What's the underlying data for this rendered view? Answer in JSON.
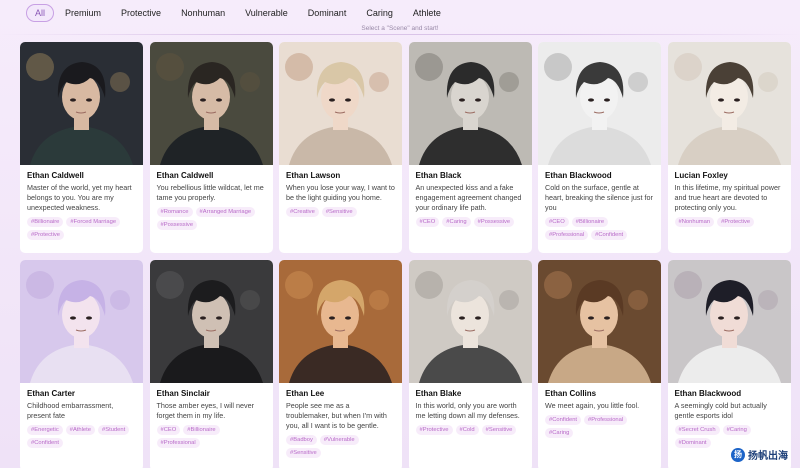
{
  "filters": [
    {
      "label": "All",
      "active": true
    },
    {
      "label": "Premium"
    },
    {
      "label": "Protective"
    },
    {
      "label": "Nonhuman"
    },
    {
      "label": "Vulnerable"
    },
    {
      "label": "Dominant"
    },
    {
      "label": "Caring"
    },
    {
      "label": "Athlete"
    }
  ],
  "subtitle": "Select a \"Scene\" and start!",
  "cards": [
    {
      "name": "Ethan Caldwell",
      "desc": "Master of the world, yet my heart belongs to you. You are my unexpected weakness.",
      "tags": [
        "#Billionaire",
        "#Forced Marriage",
        "#Protective"
      ]
    },
    {
      "name": "Ethan Caldwell",
      "desc": "You rebellious little wildcat, let me tame you properly.",
      "tags": [
        "#Romance",
        "#Arranged Marriage",
        "#Possessive"
      ]
    },
    {
      "name": "Ethan Lawson",
      "desc": "When you lose your way, I want to be the light guiding you home.",
      "tags": [
        "#Creative",
        "#Sensitive"
      ]
    },
    {
      "name": "Ethan Black",
      "desc": "An unexpected kiss and a fake engagement agreement changed your ordinary life path.",
      "tags": [
        "#CEO",
        "#Caring",
        "#Possessive"
      ]
    },
    {
      "name": "Ethan Blackwood",
      "desc": "Cold on the surface, gentle at heart, breaking the silence just for you",
      "tags": [
        "#CEO",
        "#Billionaire",
        "#Professional",
        "#Confident"
      ]
    },
    {
      "name": "Lucian Foxley",
      "desc": "In this lifetime, my spiritual power and true heart are devoted to protecting only you.",
      "tags": [
        "#Nonhuman",
        "#Protective"
      ]
    },
    {
      "name": "Ethan Carter",
      "desc": "Childhood embarrassment, present fate",
      "tags": [
        "#Energetic",
        "#Athlete",
        "#Student",
        "#Confident"
      ]
    },
    {
      "name": "Ethan Sinclair",
      "desc": "Those amber eyes, I will never forget them in my life.",
      "tags": [
        "#CEO",
        "#Billionaire",
        "#Professional"
      ]
    },
    {
      "name": "Ethan Lee",
      "desc": "People see me as a troublemaker, but when I'm with you, all I want is to be gentle.",
      "tags": [
        "#Badboy",
        "#Vulnerable",
        "#Sensitive"
      ]
    },
    {
      "name": "Ethan Blake",
      "desc": "In this world, only you are worth me letting down all my defenses.",
      "tags": [
        "#Protective",
        "#Cold",
        "#Sensitive"
      ]
    },
    {
      "name": "Ethan Collins",
      "desc": "We meet again, you little fool.",
      "tags": [
        "#Confident",
        "#Professional",
        "#Caring"
      ]
    },
    {
      "name": "Ethan Blackwood",
      "desc": "A seemingly cold but actually gentle esports idol",
      "tags": [
        "#Secret Crush",
        "#Caring",
        "#Dominant"
      ]
    }
  ],
  "card_images": [
    {
      "icon": "portrait-city-night-icon",
      "bg": "#2a2e35",
      "accent": "#c9a56a",
      "hair": "#1a1a1e",
      "skin": "#d8b9a2",
      "cloth": "#2b3a3a"
    },
    {
      "icon": "portrait-dark-suit-icon",
      "bg": "#4a4a3e",
      "accent": "#6a5a40",
      "hair": "#2a2622",
      "skin": "#d6bba6",
      "cloth": "#1f2326"
    },
    {
      "icon": "portrait-glasses-blonde-icon",
      "bg": "#e9ddd2",
      "accent": "#b07a5c",
      "hair": "#d9c7a7",
      "skin": "#efd8c8",
      "cloth": "#c9b8a8"
    },
    {
      "icon": "portrait-glasses-dark-icon",
      "bg": "#bdbab4",
      "accent": "#5c5954",
      "hair": "#2b2b2b",
      "skin": "#d9d5cf",
      "cloth": "#2e2e2e"
    },
    {
      "icon": "portrait-sketch-icon",
      "bg": "#ececec",
      "accent": "#888888",
      "hair": "#3a3a3a",
      "skin": "#f2f2f2",
      "cloth": "#dcdcdc"
    },
    {
      "icon": "portrait-fox-mask-icon",
      "bg": "#e6e2dc",
      "accent": "#c8b8a8",
      "hair": "#4a4036",
      "skin": "#f3ece4",
      "cloth": "#d8cfc4"
    },
    {
      "icon": "portrait-lavender-hair-icon",
      "bg": "#d7c8ec",
      "accent": "#b49ad8",
      "hair": "#c6b2e6",
      "skin": "#f3e3ee",
      "cloth": "#e8e0f2"
    },
    {
      "icon": "portrait-car-interior-icon",
      "bg": "#3a3a3c",
      "accent": "#6a6a6a",
      "hair": "#1c1c1e",
      "skin": "#cfc0b4",
      "cloth": "#1a1a1c"
    },
    {
      "icon": "portrait-warm-light-icon",
      "bg": "#a86a3a",
      "accent": "#e0a060",
      "hair": "#d4a66a",
      "skin": "#e8b890",
      "cloth": "#3a2a24"
    },
    {
      "icon": "portrait-cat-icon",
      "bg": "#cfcac4",
      "accent": "#8a8680",
      "hair": "#d4d0cc",
      "skin": "#ece4dc",
      "cloth": "#4a4a4a"
    },
    {
      "icon": "portrait-brown-hair-icon",
      "bg": "#6a4a30",
      "accent": "#c89060",
      "hair": "#5a3a24",
      "skin": "#e6c2a2",
      "cloth": "#c8a886"
    },
    {
      "icon": "portrait-bed-icon",
      "bg": "#c9c6c8",
      "accent": "#9a8a9a",
      "hair": "#1e1e28",
      "skin": "#f0dcd6",
      "cloth": "#ececec"
    }
  ],
  "watermark": {
    "icon": "brand-logo-icon",
    "logo_char": "扬",
    "text": "扬帆出海"
  }
}
